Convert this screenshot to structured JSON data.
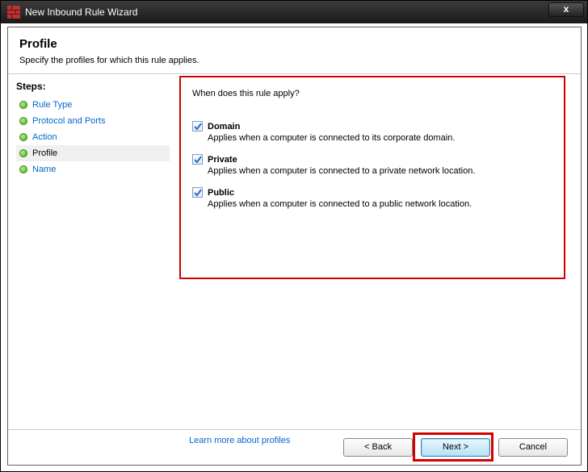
{
  "window": {
    "title": "New Inbound Rule Wizard",
    "close_label": "x"
  },
  "header": {
    "title": "Profile",
    "subtitle": "Specify the profiles for which this rule applies."
  },
  "sidebar": {
    "steps_label": "Steps:",
    "items": [
      {
        "label": "Rule Type",
        "current": false
      },
      {
        "label": "Protocol and Ports",
        "current": false
      },
      {
        "label": "Action",
        "current": false
      },
      {
        "label": "Profile",
        "current": true
      },
      {
        "label": "Name",
        "current": false
      }
    ]
  },
  "content": {
    "question": "When does this rule apply?",
    "profiles": [
      {
        "name": "Domain",
        "checked": true,
        "desc": "Applies when a computer is connected to its corporate domain."
      },
      {
        "name": "Private",
        "checked": true,
        "desc": "Applies when a computer is connected to a private network location."
      },
      {
        "name": "Public",
        "checked": true,
        "desc": "Applies when a computer is connected to a public network location."
      }
    ],
    "learn_more": "Learn more about profiles"
  },
  "footer": {
    "back": "< Back",
    "next": "Next >",
    "cancel": "Cancel"
  }
}
